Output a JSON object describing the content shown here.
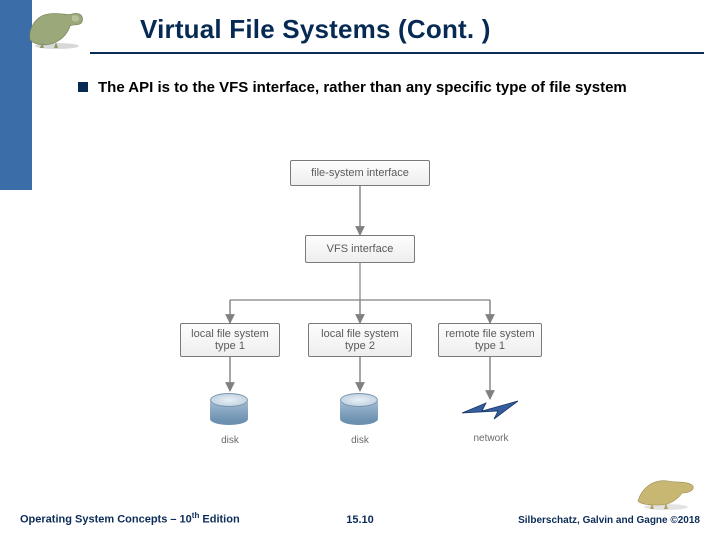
{
  "title": "Virtual File Systems (Cont. )",
  "bullet": "The API is to the VFS interface, rather than any specific type of file system",
  "diagram": {
    "box_top": "file-system interface",
    "box_vfs": "VFS interface",
    "box_b1_l1": "local file system",
    "box_b1_l2": "type 1",
    "box_b2_l1": "local file system",
    "box_b2_l2": "type 2",
    "box_b3_l1": "remote file system",
    "box_b3_l2": "type 1",
    "disk1_label": "disk",
    "disk2_label": "disk",
    "network_label": "network"
  },
  "footer": {
    "left_prefix": "Operating System Concepts – 10",
    "left_suffix": " Edition",
    "left_sup": "th",
    "center": "15.10",
    "right": "Silberschatz, Galvin and Gagne ©2018"
  }
}
